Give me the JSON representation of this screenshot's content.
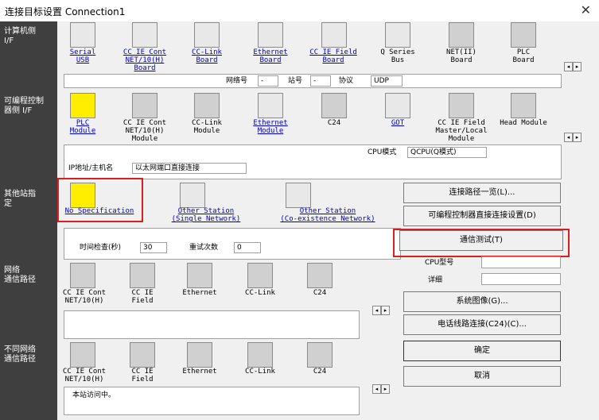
{
  "window": {
    "title": "连接目标设置 Connection1",
    "close_glyph": "✕"
  },
  "sidebar": {
    "pc_side": "计算机侧\nI/F",
    "plc_side": "可编程控制\n器侧 I/F",
    "other_station": "其他站指\n定",
    "network_route": "网络\n通信路径",
    "diff_network": "不同网络\n通信路径"
  },
  "pc_if": {
    "items": [
      {
        "label": "Serial\nUSB",
        "link": true
      },
      {
        "label": "CC IE Cont\nNET/10(H)\nBoard",
        "link": true
      },
      {
        "label": "CC-Link\nBoard",
        "link": true
      },
      {
        "label": "Ethernet\nBoard",
        "link": true
      },
      {
        "label": "CC IE Field\nBoard",
        "link": true
      },
      {
        "label": "Q Series\nBus",
        "link": false
      },
      {
        "label": "NET(II)\nBoard",
        "link": false
      },
      {
        "label": "PLC\nBoard",
        "link": false
      }
    ],
    "network_no_label": "网络号",
    "network_no_value": "-",
    "station_no_label": "站号",
    "station_no_value": "-",
    "protocol_label": "协议",
    "protocol_value": "UDP"
  },
  "plc_if": {
    "items": [
      {
        "label": "PLC\nModule",
        "link": true
      },
      {
        "label": "CC IE Cont\nNET/10(H)\nModule",
        "link": false
      },
      {
        "label": "CC-Link\nModule",
        "link": false
      },
      {
        "label": "Ethernet\nModule",
        "link": true
      },
      {
        "label": "C24",
        "link": false
      },
      {
        "label": "GOT",
        "link": true
      },
      {
        "label": "CC IE Field\nMaster/Local\nModule",
        "link": false
      },
      {
        "label": "Head Module",
        "link": false
      }
    ],
    "cpu_mode_label": "CPU模式",
    "cpu_mode_value": "QCPU(Q模式)",
    "ip_label": "IP地址/主机名",
    "ip_value": "以太网端口直接连接"
  },
  "other_station": {
    "options": [
      {
        "label": "No Specification"
      },
      {
        "label": "Other Station\n(Single Network)"
      },
      {
        "label": "Other Station\n(Co-existence Network)"
      }
    ],
    "time_check_label": "时间检查(秒)",
    "time_check_value": "30",
    "retry_label": "重试次数",
    "retry_value": "0"
  },
  "network_route": {
    "items": [
      "CC IE Cont\nNET/10(H)",
      "CC IE\nField",
      "Ethernet",
      "CC-Link",
      "C24"
    ]
  },
  "diff_network": {
    "items": [
      "CC IE Cont\nNET/10(H)",
      "CC IE\nField",
      "Ethernet",
      "CC-Link",
      "C24"
    ],
    "status_text": "本站访问中。"
  },
  "buttons": {
    "route_list": "连接路径一览(L)...",
    "direct_connect": "可编程控制器直接连接设置(D)",
    "comm_test": "通信测试(T)",
    "system_image": "系统图像(G)...",
    "phone_line": "电话线路连接(C24)(C)...",
    "ok": "确定",
    "cancel": "取消"
  },
  "info": {
    "cpu_type_label": "CPU型号",
    "detail_label": "详细"
  },
  "scroll": {
    "left": "◂",
    "right": "▸"
  },
  "colors": {
    "sidebar": "#3f3f3f",
    "highlight_box": "#d92020",
    "link": "#0000cc",
    "plc_icon": "#ffee00"
  }
}
